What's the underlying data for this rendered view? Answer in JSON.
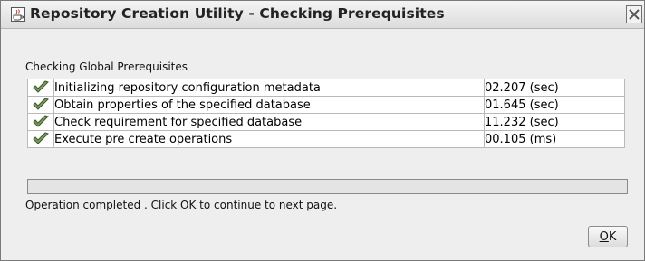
{
  "window": {
    "title": "Repository Creation Utility - Checking Prerequisites",
    "app_icon": "java-cup-icon",
    "close_icon": "close-icon"
  },
  "section": {
    "label": "Checking Global Prerequisites"
  },
  "checks": [
    {
      "status_icon": "checkmark-icon",
      "task": "Initializing repository configuration metadata",
      "time": "02.207 (sec)"
    },
    {
      "status_icon": "checkmark-icon",
      "task": "Obtain properties of the specified database",
      "time": "01.645 (sec)"
    },
    {
      "status_icon": "checkmark-icon",
      "task": "Check requirement for specified database",
      "time": "11.232 (sec)"
    },
    {
      "status_icon": "checkmark-icon",
      "task": "Execute pre create operations",
      "time": "00.105 (ms)"
    }
  ],
  "progress": {
    "fraction": 1.0,
    "status_text": "Operation completed . Click OK to continue to next page."
  },
  "buttons": {
    "ok_mnemonic": "O",
    "ok_rest": "K"
  },
  "colors": {
    "check_green": "#7a9a5a",
    "check_dark": "#3c5a2c"
  }
}
